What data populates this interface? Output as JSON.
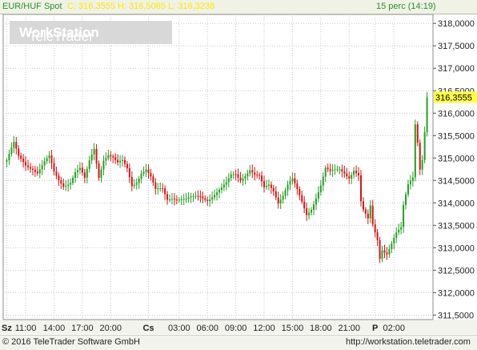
{
  "header": {
    "symbol": "EUR/HUF Spot",
    "quote": "C: 316,3555 H: 316,5065 L: 316,3238",
    "interval": "15 perc (14:19)"
  },
  "watermark": {
    "brand": "TeleTrader",
    "product": "WorkStation"
  },
  "footer": {
    "copyright": "© 2016 TeleTrader Software GmbH",
    "url": "http://workstation.teletrader.com"
  },
  "colors": {
    "up": "#22a022",
    "down": "#dd1111",
    "grid": "#c8c8c8",
    "last_price_bg": "#ffff44",
    "header_text": "#2e8b2e",
    "quote_text": "#ffe600"
  },
  "chart_data": {
    "type": "candlestick",
    "title": "EUR/HUF Spot",
    "ylim": [
      311.4,
      318.2
    ],
    "yticks": [
      "318,0000",
      "317,5000",
      "317,0000",
      "316,5000",
      "316,0000",
      "315,5000",
      "315,0000",
      "314,5000",
      "314,0000",
      "313,5000",
      "313,0000",
      "312,5000",
      "312,0000",
      "311,5000"
    ],
    "ytick_values": [
      318.0,
      317.5,
      317.0,
      316.5,
      316.0,
      315.5,
      315.0,
      314.5,
      314.0,
      313.5,
      313.0,
      312.5,
      312.0,
      311.5
    ],
    "last_price": 316.3555,
    "last_price_label": "316,3555",
    "xticks": [
      {
        "label": "Sz",
        "bold": true
      },
      {
        "label": "11:00"
      },
      {
        "label": "14:00"
      },
      {
        "label": "17:00"
      },
      {
        "label": "20:00"
      },
      {
        "label": "Cs",
        "bold": true
      },
      {
        "label": "03:00"
      },
      {
        "label": "06:00"
      },
      {
        "label": "09:00"
      },
      {
        "label": "12:00"
      },
      {
        "label": "15:00"
      },
      {
        "label": "18:00"
      },
      {
        "label": "21:00"
      },
      {
        "label": "P",
        "bold": true
      },
      {
        "label": "02:00"
      }
    ],
    "xtick_slots": [
      0,
      8,
      20,
      32,
      44,
      60,
      73,
      85,
      97,
      109,
      121,
      133,
      145,
      156,
      164
    ],
    "n_slots": 180,
    "keypoints": [
      [
        0,
        314.95
      ],
      [
        3,
        315.3
      ],
      [
        5,
        315.0
      ],
      [
        8,
        314.85
      ],
      [
        11,
        314.8
      ],
      [
        13,
        314.7
      ],
      [
        16,
        314.9
      ],
      [
        18,
        315.0
      ],
      [
        20,
        314.65
      ],
      [
        22,
        314.5
      ],
      [
        24,
        314.4
      ],
      [
        27,
        314.5
      ],
      [
        29,
        314.7
      ],
      [
        31,
        314.75
      ],
      [
        33,
        314.5
      ],
      [
        35,
        314.9
      ],
      [
        37,
        315.2
      ],
      [
        39,
        314.6
      ],
      [
        41,
        315.0
      ],
      [
        43,
        315.1
      ],
      [
        45,
        315.0
      ],
      [
        47,
        314.85
      ],
      [
        49,
        314.9
      ],
      [
        51,
        314.75
      ],
      [
        53,
        314.4
      ],
      [
        55,
        314.5
      ],
      [
        57,
        314.7
      ],
      [
        59,
        314.75
      ],
      [
        61,
        314.55
      ],
      [
        63,
        314.25
      ],
      [
        66,
        314.3
      ],
      [
        68,
        314.1
      ],
      [
        70,
        314.15
      ],
      [
        73,
        314.1
      ],
      [
        76,
        314.05
      ],
      [
        79,
        314.1
      ],
      [
        82,
        314.15
      ],
      [
        85,
        314.1
      ],
      [
        88,
        314.2
      ],
      [
        91,
        314.3
      ],
      [
        93,
        314.4
      ],
      [
        95,
        314.6
      ],
      [
        97,
        314.65
      ],
      [
        99,
        314.55
      ],
      [
        101,
        314.65
      ],
      [
        103,
        314.75
      ],
      [
        105,
        314.6
      ],
      [
        107,
        314.55
      ],
      [
        109,
        314.3
      ],
      [
        111,
        314.4
      ],
      [
        113,
        314.3
      ],
      [
        115,
        314.05
      ],
      [
        117,
        314.2
      ],
      [
        119,
        314.4
      ],
      [
        121,
        314.5
      ],
      [
        123,
        314.25
      ],
      [
        125,
        314.0
      ],
      [
        127,
        313.75
      ],
      [
        129,
        313.9
      ],
      [
        131,
        314.15
      ],
      [
        133,
        314.4
      ],
      [
        135,
        314.75
      ],
      [
        137,
        314.65
      ],
      [
        139,
        314.7
      ],
      [
        141,
        314.75
      ],
      [
        143,
        314.7
      ],
      [
        145,
        314.6
      ],
      [
        147,
        314.75
      ],
      [
        149,
        314.6
      ],
      [
        150,
        314.0
      ],
      [
        151,
        313.8
      ],
      [
        153,
        313.6
      ],
      [
        154,
        313.9
      ],
      [
        155,
        313.5
      ],
      [
        157,
        313.2
      ],
      [
        158,
        312.8
      ],
      [
        159,
        313.0
      ],
      [
        161,
        312.9
      ],
      [
        163,
        313.1
      ],
      [
        165,
        313.3
      ],
      [
        167,
        313.4
      ],
      [
        168,
        313.9
      ],
      [
        170,
        314.4
      ],
      [
        172,
        314.6
      ],
      [
        173,
        315.8
      ],
      [
        174,
        315.4
      ],
      [
        175,
        314.8
      ],
      [
        176,
        315.0
      ],
      [
        177,
        315.6
      ],
      [
        178,
        316.35
      ]
    ]
  }
}
